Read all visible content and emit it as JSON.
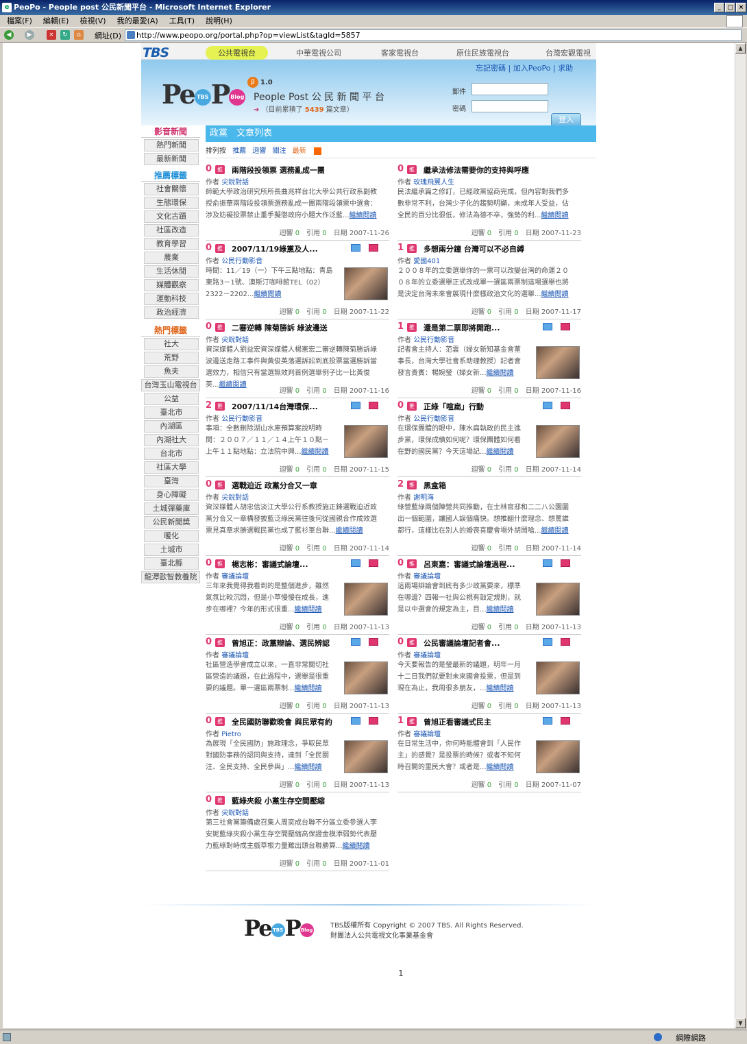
{
  "window": {
    "title": "PeoPo - People post 公民新聞平台 - Microsoft Internet Explorer"
  },
  "menu": [
    "檔案(F)",
    "編輯(E)",
    "檢視(V)",
    "我的最愛(A)",
    "工具(T)",
    "說明(H)"
  ],
  "address": {
    "label": "網址(D)",
    "url": "http://www.peopo.org/portal.php?op=viewList&tagId=5857"
  },
  "status": {
    "zone": "網際網路"
  },
  "site": {
    "tbs_logo": "TBS",
    "nav": [
      "公共電視台",
      "中華電視公司",
      "客家電視台",
      "原住民族電視台",
      "台灣宏觀電視"
    ],
    "header_links": [
      "忘記密碼",
      "加入PeoPo",
      "求助"
    ],
    "beta_badge": "β",
    "beta_version": "1.0",
    "slogan": "People Post 公 民 新 聞 平 台",
    "count_prefix": "（目前累積了",
    "count_value": "5439",
    "count_suffix": "篇文章）",
    "login_email_label": "郵件",
    "login_password_label": "密碼",
    "login_button": "登入"
  },
  "sidebar": {
    "section1": "影音新聞",
    "section1_items": [
      "熱門新聞",
      "最新新聞"
    ],
    "section2": "推薦標籤",
    "section2_items": [
      "社會關懷",
      "生態環保",
      "文化古蹟",
      "社區改造",
      "教育學習",
      "農業",
      "生活休閒",
      "媒體觀察",
      "運動科技",
      "政治經濟"
    ],
    "section3": "熱門標籤",
    "section3_items": [
      "社大",
      "荒野",
      "魚夫",
      "台灣玉山電視台",
      "公益",
      "臺北市",
      "內湖區",
      "內湖社大",
      "台北市",
      "社區大學",
      "臺灣",
      "身心障礙",
      "土城彈藥庫",
      "公民新聞獎",
      "暖化",
      "土城市",
      "臺北縣",
      "龍潭歐智教養院"
    ]
  },
  "main": {
    "title": "政黨　文章列表",
    "sort_label": "排列按",
    "sort_options": [
      "推薦",
      "迴響",
      "關注",
      "最新"
    ],
    "articles": [
      {
        "count": "0",
        "tag": "推",
        "title": "兩階段投領票 選務亂成一團",
        "author_label": "作者",
        "author": "尖銳對話",
        "body": "師範大學政治研究所所長曲兆祥台北大學公共行政系副教授俞振華兩階段投領票選務亂成一團兩階段領票中選會：涉及妨礙投票禁止重手擬懲政府小題大作泛藍...",
        "more": "繼續閱讀",
        "replies": "0",
        "cites": "0",
        "date": "2007-11-26",
        "img": false
      },
      {
        "count": "0",
        "tag": "推",
        "title": "繼承法修法需要你的支持與呼應",
        "author_label": "作者",
        "author": "玫瑰飛翼人生",
        "body": "民法繼承篇之修訂，已經政黨協商完成，但內容對我們多數非常不利，台灣少子化的趨勢明顯，未成年人受益，佔全民的百分比很低，修法為德不卒，強勢的利...",
        "more": "繼續閱讀",
        "replies": "0",
        "cites": "0",
        "date": "2007-11-23",
        "img": false
      },
      {
        "count": "0",
        "tag": "推",
        "title": "2007/11/19綠黨及人...",
        "author_label": "作者",
        "author": "公民行動影音",
        "body": "時間：11／19（一）下午三點地點：青島東路3－1號、澳斯汀咖啡館TEL（02）2322－2202...",
        "more": "繼續閱讀",
        "replies": "0",
        "cites": "0",
        "date": "2007-11-22",
        "img": true
      },
      {
        "count": "1",
        "tag": "推",
        "title": "多想兩分鐘 台灣可以不必自縛",
        "author_label": "作者",
        "author": "愛國401",
        "body": "２００８年的立委選舉你的一票可以改變台灣的命運２００８年的立委選舉正式改成單一選區兩票制這場選舉也將是決定台灣未來會展現什麼樣政治文化的選舉...",
        "more": "繼續閱讀",
        "replies": "0",
        "cites": "0",
        "date": "2007-11-17",
        "img": false
      },
      {
        "count": "0",
        "tag": "推",
        "title": "二審逆轉 陳菊勝訴 綠波邊送",
        "author_label": "作者",
        "author": "尖銳對話",
        "body": "資深媒體人劉益宏資深媒體人楊憲宏二審逆轉陳菊勝訴綠波邊送走路工事件與黃俊英落選訴訟到底投票當選勝訴當選效力，相信只有當選無效判首例選舉例子比一比黃俊英...",
        "more": "繼續閱讀",
        "replies": "0",
        "cites": "0",
        "date": "2007-11-16",
        "img": false
      },
      {
        "count": "1",
        "tag": "推",
        "title": "還是第二票即將開跑...",
        "author_label": "作者",
        "author": "公民行動影音",
        "body": "記者會主持人：范雲（婦女新知基金會董事長，台灣大學社會系助理教授）記者會發言貴賓：楊婉瑩（婦女新...",
        "more": "繼續閱讀",
        "replies": "0",
        "cites": "0",
        "date": "2007-11-16",
        "img": true
      },
      {
        "count": "2",
        "tag": "推",
        "title": "2007/11/14台灣環保...",
        "author_label": "作者",
        "author": "公民行動影音",
        "body": "事項：全數刪除湖山水庫預算案說明時間：２００７／１１／１４上午１０點－上午１１點地點：立法院中興...",
        "more": "繼續閱讀",
        "replies": "0",
        "cites": "0",
        "date": "2007-11-15",
        "img": true
      },
      {
        "count": "0",
        "tag": "推",
        "title": "正綠「喧扁」行動",
        "author_label": "作者",
        "author": "公民行動影音",
        "body": "在環保團體的眼中，陳水扁執政的民主進步黨，環保成績如何呢？環保團體如何看在野的國民黨？今天這場記...",
        "more": "繼續閱讀",
        "replies": "0",
        "cites": "0",
        "date": "2007-11-14",
        "img": true
      },
      {
        "count": "0",
        "tag": "推",
        "title": "選戰迫近 政黨分合又一章",
        "author_label": "作者",
        "author": "尖銳對話",
        "body": "資深媒體人胡忠信淡江大學公行系教授施正鋒選戰迫近政黨分合又一章構發披藍泛綠民黨往後何從國親合作成效選票見真章求勝選戰民黨也成了藍衫軍台聯...",
        "more": "繼續閱讀",
        "replies": "0",
        "cites": "0",
        "date": "2007-11-14",
        "img": false
      },
      {
        "count": "2",
        "tag": "推",
        "title": "黑盒箱",
        "author_label": "作者",
        "author": "謝明海",
        "body": "綠營藍綠兩個陣營共同推動，在士林官邸和二二八公園圍出一個範圍，讓國人誤個痛快。想推翻什麼理念、想罵誰都行，這樣比在別人的婚喪喜慶會場外胡鬧嗆...",
        "more": "繼續閱讀",
        "replies": "0",
        "cites": "0",
        "date": "2007-11-14",
        "img": false
      },
      {
        "count": "0",
        "tag": "推",
        "title": "楊志彬：審議式論壇...",
        "author_label": "作者",
        "author": "審議論壇",
        "body": "三年來我覺得我看到的是整個進步，雖然氣氛比較沉悶，但是小草慢慢在成長，進步在哪裡？今年的形式很重...",
        "more": "繼續閱讀",
        "replies": "0",
        "cites": "0",
        "date": "2007-11-13",
        "img": true
      },
      {
        "count": "0",
        "tag": "推",
        "title": "呂東嘉：審議式論壇過程...",
        "author_label": "作者",
        "author": "審議論壇",
        "body": "這兩場辯論會到底有多少政黨要來，標準在哪邊？四報一社與公視有敲定規則，就是以中選會的規定為主，目...",
        "more": "繼續閱讀",
        "replies": "0",
        "cites": "0",
        "date": "2007-11-13",
        "img": true
      },
      {
        "count": "0",
        "tag": "推",
        "title": "曾旭正：政黨辯論、選民辨認",
        "author_label": "作者",
        "author": "審議論壇",
        "body": "社區營造學會成立以來，一直非常關切社區營造的議題，在此過程中，選舉是很重要的議題。單一選區兩票制...",
        "more": "繼續閱讀",
        "replies": "0",
        "cites": "0",
        "date": "2007-11-13",
        "img": true
      },
      {
        "count": "0",
        "tag": "推",
        "title": "公民審議論壇記者會...",
        "author_label": "作者",
        "author": "審議論壇",
        "body": "今天要報告的是瑩最新的議題，明年一月十二日我們就要對未來國會投票，但是到現在為止，我周很多朋友，...",
        "more": "繼續閱讀",
        "replies": "0",
        "cites": "0",
        "date": "2007-11-13",
        "img": true
      },
      {
        "count": "0",
        "tag": "推",
        "title": "全民國防聯歡晚會 與民眾有約",
        "author_label": "作者",
        "author": "Pietro",
        "body": "為展現「全民國防」施政理念，爭取民眾對國防事務的認同與支持，達到「全民關注、全民支持、全民參與」...",
        "more": "繼續閱讀",
        "replies": "0",
        "cites": "0",
        "date": "2007-11-13",
        "img": true
      },
      {
        "count": "1",
        "tag": "推",
        "title": "曾旭正看審議式民主",
        "author_label": "作者",
        "author": "審議論壇",
        "body": "在日常生活中，你何時能體會到「人民作主」的感覺？是投票的時候？或者不知何時召開的里民大會？或者是...",
        "more": "繼續閱讀",
        "replies": "0",
        "cites": "0",
        "date": "2007-11-07",
        "img": true
      },
      {
        "count": "0",
        "tag": "推",
        "title": "藍綠夾殺 小黨生存空間壓縮",
        "author_label": "作者",
        "author": "尖銳對話",
        "body": "第三社會黨籌備處召集人周奕成台聯不分區立委參選人李安妮藍綠夾殺小黨生存空間壓縮高保證金模添弱勢代表壓力藍綠對峙成主戲草根力量難出頭台聯勝算...",
        "more": "繼續閱讀",
        "replies": "0",
        "cites": "0",
        "date": "2007-11-01",
        "img": false
      }
    ],
    "replies_label": "迴響",
    "cites_label": "引用",
    "date_label": "日期",
    "page": "1"
  },
  "footer": {
    "line1": "TBS版權所有 Copyright © 2007 TBS. All Rights Reserved.",
    "line2": "財團法人公共電視文化事業基金會"
  }
}
